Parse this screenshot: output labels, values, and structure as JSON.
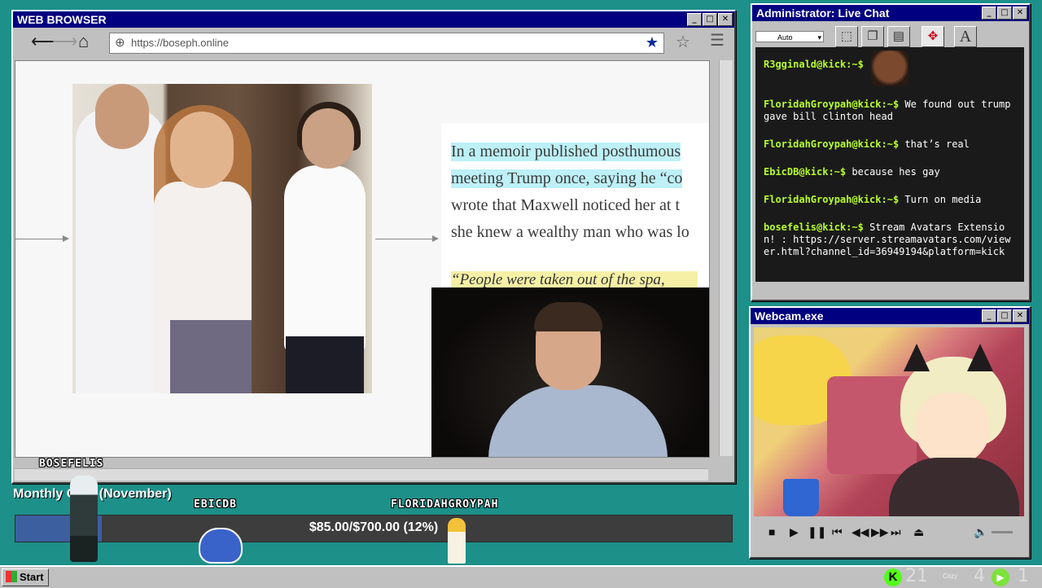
{
  "browser": {
    "title": "WEB BROWSER",
    "url": "https://boseph.online",
    "nav": {
      "back": "🡐",
      "forward": "🡒",
      "home": "⌂"
    },
    "article_lines": [
      "In a memoir published posthumous",
      "meeting Trump once, saying he “co",
      "wrote that Maxwell noticed her at t",
      "she knew a wealthy man who was lo"
    ],
    "article_quote": "“People were taken out of the spa,"
  },
  "chat": {
    "title": "Administrator: Live Chat",
    "font_select": "Auto",
    "tools": [
      "select-icon",
      "copy-icon",
      "paste-icon",
      "move-icon",
      "text-icon"
    ],
    "text_tool_label": "A",
    "messages": [
      {
        "user": "R3gginald@kick:~$",
        "text": ""
      },
      {
        "user": "FloridahGroypah@kick:~$",
        "text": "We found out trump gave bill clinton head"
      },
      {
        "user": "FloridahGroypah@kick:~$",
        "text": "that’s real"
      },
      {
        "user": "EbicDB@kick:~$",
        "text": "because hes gay"
      },
      {
        "user": "FloridahGroypah@kick:~$",
        "text": "Turn on media"
      },
      {
        "user": "bosefelis@kick:~$",
        "text": "Stream Avatars Extension! : https://server.streamavatars.com/viewer.html?channel_id=36949194&platform=kick"
      }
    ]
  },
  "webcam": {
    "title": "Webcam.exe"
  },
  "goal": {
    "title": "Monthly Goal (November)",
    "amount_text": "$85.00/$700.00 (12%)",
    "progress_fraction": 0.12
  },
  "avatars": {
    "names": [
      "BOSEFELIS",
      "EBICDB",
      "FLORIDAHGROYPAH"
    ]
  },
  "taskbar": {
    "start_label": "Start",
    "kick_count": "21",
    "viewer_count": "4",
    "extra_count": "1",
    "small_label": "Cozy"
  },
  "colors": {
    "desktop": "#1d9089",
    "titlebar": "#000080",
    "chat_user": "#b8ff2a",
    "kick_green": "#53fc18"
  }
}
